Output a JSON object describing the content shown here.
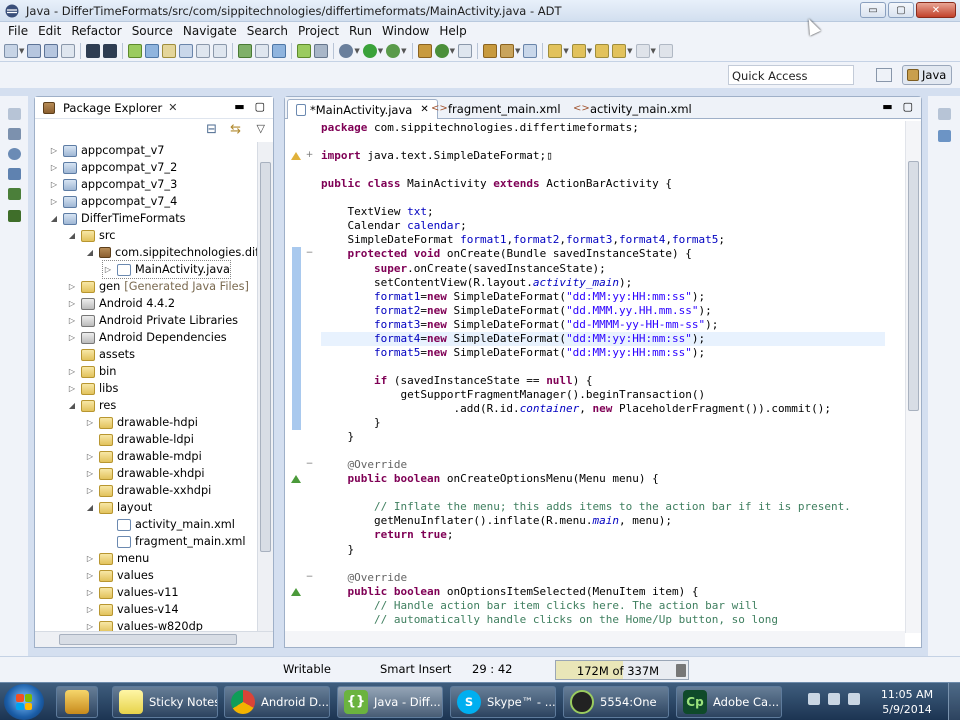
{
  "window": {
    "title": "Java - DifferTimeFormats/src/com/sippitechnologies/differtimeformats/MainActivity.java - ADT",
    "controls": {
      "minimize": "▭",
      "maximize": "▢",
      "close": "✕"
    }
  },
  "menu": [
    "File",
    "Edit",
    "Refactor",
    "Source",
    "Navigate",
    "Search",
    "Project",
    "Run",
    "Window",
    "Help"
  ],
  "quick_access": {
    "placeholder": "Quick Access"
  },
  "perspective": {
    "label": "Java"
  },
  "package_explorer": {
    "title": "Package Explorer",
    "close": "✕",
    "minimize": "▬",
    "maximize": "▢",
    "collapse": "⊟",
    "link": "⇆",
    "menu": "▽",
    "tree": [
      {
        "label": "appcompat_v7",
        "icon": "project",
        "twisty": "▷"
      },
      {
        "label": "appcompat_v7_2",
        "icon": "project",
        "twisty": "▷"
      },
      {
        "label": "appcompat_v7_3",
        "icon": "project",
        "twisty": "▷"
      },
      {
        "label": "appcompat_v7_4",
        "icon": "project",
        "twisty": "▷"
      },
      {
        "label": "DifferTimeFormats",
        "icon": "project",
        "twisty": "◢"
      },
      {
        "label": "src",
        "icon": "folder",
        "twisty": "◢"
      },
      {
        "label": "com.sippitechnologies.differ",
        "icon": "package",
        "twisty": "◢"
      },
      {
        "label": "MainActivity.java",
        "icon": "java",
        "twisty": "▷"
      },
      {
        "label": "gen",
        "decoration": "[Generated Java Files]",
        "icon": "folder",
        "twisty": "▷"
      },
      {
        "label": "Android 4.4.2",
        "icon": "library",
        "twisty": "▷"
      },
      {
        "label": "Android Private Libraries",
        "icon": "library",
        "twisty": "▷"
      },
      {
        "label": "Android Dependencies",
        "icon": "library",
        "twisty": "▷"
      },
      {
        "label": "assets",
        "icon": "folder",
        "twisty": ""
      },
      {
        "label": "bin",
        "icon": "folder",
        "twisty": "▷"
      },
      {
        "label": "libs",
        "icon": "folder",
        "twisty": "▷"
      },
      {
        "label": "res",
        "icon": "folder",
        "twisty": "◢"
      },
      {
        "label": "drawable-hdpi",
        "icon": "folder",
        "twisty": "▷"
      },
      {
        "label": "drawable-ldpi",
        "icon": "folder",
        "twisty": ""
      },
      {
        "label": "drawable-mdpi",
        "icon": "folder",
        "twisty": "▷"
      },
      {
        "label": "drawable-xhdpi",
        "icon": "folder",
        "twisty": "▷"
      },
      {
        "label": "drawable-xxhdpi",
        "icon": "folder",
        "twisty": "▷"
      },
      {
        "label": "layout",
        "icon": "folder",
        "twisty": "◢"
      },
      {
        "label": "activity_main.xml",
        "icon": "xml",
        "twisty": ""
      },
      {
        "label": "fragment_main.xml",
        "icon": "xml",
        "twisty": ""
      },
      {
        "label": "menu",
        "icon": "folder",
        "twisty": "▷"
      },
      {
        "label": "values",
        "icon": "folder",
        "twisty": "▷"
      },
      {
        "label": "values-v11",
        "icon": "folder",
        "twisty": "▷"
      },
      {
        "label": "values-v14",
        "icon": "folder",
        "twisty": "▷"
      },
      {
        "label": "values-w820dp",
        "icon": "folder",
        "twisty": "▷"
      }
    ]
  },
  "editor": {
    "tabs": [
      {
        "label": "*MainActivity.java",
        "active": true
      },
      {
        "label": "fragment_main.xml",
        "active": false
      },
      {
        "label": "activity_main.xml",
        "active": false
      }
    ],
    "close": "✕",
    "minimize": "▬",
    "maximize": "▢",
    "lines": [
      [
        [
          "package ",
          "kw"
        ],
        [
          "com.sippitechnologies.differtimeformats;",
          ""
        ]
      ],
      [],
      [
        [
          "import ",
          "kw"
        ],
        [
          "java.text.SimpleDateFormat;",
          ""
        ],
        [
          "▯",
          ""
        ]
      ],
      [],
      [
        [
          "public ",
          "kw"
        ],
        [
          "class ",
          "kw"
        ],
        [
          "MainActivity ",
          ""
        ],
        [
          "extends ",
          "kw"
        ],
        [
          "ActionBarActivity {",
          ""
        ]
      ],
      [],
      [
        [
          "    TextView ",
          ""
        ],
        [
          "txt",
          ""
        ],
        [
          ";",
          ""
        ]
      ],
      [
        [
          "    Calendar ",
          ""
        ],
        [
          "calendar",
          ""
        ],
        [
          ";",
          ""
        ]
      ],
      [
        [
          "    SimpleDateFormat ",
          ""
        ],
        [
          "format1",
          ""
        ],
        [
          ",",
          ""
        ],
        [
          "format2",
          ""
        ],
        [
          ",",
          ""
        ],
        [
          "format3",
          ""
        ],
        [
          ",",
          ""
        ],
        [
          "format4",
          ""
        ],
        [
          ",",
          ""
        ],
        [
          "format5",
          ""
        ],
        [
          ";",
          ""
        ]
      ],
      [
        [
          "    ",
          "kw"
        ],
        [
          "protected ",
          "kw"
        ],
        [
          "void ",
          "kw"
        ],
        [
          "onCreate(Bundle savedInstanceState) {",
          ""
        ]
      ],
      [
        [
          "        ",
          ""
        ],
        [
          "super",
          ""
        ],
        [
          ".onCreate(savedInstanceState);",
          ""
        ]
      ],
      [
        [
          "        setContentView(R.layout.",
          ""
        ],
        [
          "activity_main",
          ""
        ],
        [
          ");",
          ""
        ]
      ],
      [
        [
          "        ",
          ""
        ],
        [
          "format1",
          ""
        ],
        [
          "=",
          ""
        ],
        [
          "new ",
          "kw"
        ],
        [
          "SimpleDateFormat(",
          ""
        ],
        [
          "\"dd:MM:yy:HH:mm:ss\"",
          ""
        ],
        [
          ");",
          ""
        ]
      ],
      [
        [
          "        ",
          ""
        ],
        [
          "format2",
          ""
        ],
        [
          "=",
          ""
        ],
        [
          "new ",
          "kw"
        ],
        [
          "SimpleDateFormat(",
          ""
        ],
        [
          "\"dd.MMM.yy.HH.mm.ss\"",
          ""
        ],
        [
          ");",
          ""
        ]
      ],
      [
        [
          "        ",
          ""
        ],
        [
          "format3",
          ""
        ],
        [
          "=",
          ""
        ],
        [
          "new ",
          "kw"
        ],
        [
          "SimpleDateFormat(",
          ""
        ],
        [
          "\"dd-MMMM-yy-HH-mm-ss\"",
          ""
        ],
        [
          ");",
          ""
        ]
      ],
      [
        [
          "        ",
          ""
        ],
        [
          "format4",
          ""
        ],
        [
          "=",
          ""
        ],
        [
          "new ",
          "kw"
        ],
        [
          "SimpleDateFormat(",
          ""
        ],
        [
          "\"dd:MM:yy:HH:mm:ss\"",
          ""
        ],
        [
          ");",
          ""
        ]
      ],
      [
        [
          "        ",
          ""
        ],
        [
          "format5",
          ""
        ],
        [
          "=",
          ""
        ],
        [
          "new ",
          "kw"
        ],
        [
          "SimpleDateFormat(",
          ""
        ],
        [
          "\"dd:MM:yy:HH:mm:ss\"",
          ""
        ],
        [
          ");",
          ""
        ]
      ],
      [],
      [
        [
          "        ",
          ""
        ],
        [
          "if ",
          "kw"
        ],
        [
          "(savedInstanceState == ",
          ""
        ],
        [
          "null",
          ""
        ],
        [
          ") {",
          ""
        ]
      ],
      [
        [
          "            getSupportFragmentManager().beginTransaction()",
          ""
        ]
      ],
      [
        [
          "                    .add(R.id.",
          ""
        ],
        [
          "container",
          ""
        ],
        [
          ", ",
          ""
        ],
        [
          "new ",
          "kw"
        ],
        [
          "PlaceholderFragment()).commit();",
          ""
        ]
      ],
      [
        [
          "        }",
          ""
        ]
      ],
      [
        [
          "    }",
          ""
        ]
      ],
      [],
      [
        [
          "    ",
          ""
        ],
        [
          "@Override",
          ""
        ]
      ],
      [
        [
          "    ",
          ""
        ],
        [
          "public ",
          "kw"
        ],
        [
          "boolean ",
          "kw"
        ],
        [
          "onCreateOptionsMenu(Menu menu) {",
          ""
        ]
      ],
      [],
      [
        [
          "        ",
          ""
        ],
        [
          "// Inflate the menu; this adds items to the action bar if it is present.",
          ""
        ]
      ],
      [
        [
          "        getMenuInflater().inflate(R.menu.",
          ""
        ],
        [
          "main",
          ""
        ],
        [
          ", menu);",
          ""
        ]
      ],
      [
        [
          "        ",
          ""
        ],
        [
          "return ",
          "kw"
        ],
        [
          "true",
          ""
        ],
        [
          ";",
          ""
        ]
      ],
      [
        [
          "    }",
          ""
        ]
      ],
      [],
      [
        [
          "    ",
          ""
        ],
        [
          "@Override",
          ""
        ]
      ],
      [
        [
          "    ",
          ""
        ],
        [
          "public ",
          "kw"
        ],
        [
          "boolean ",
          "kw"
        ],
        [
          "onOptionsItemSelected(MenuItem item) {",
          ""
        ]
      ],
      [
        [
          "        ",
          ""
        ],
        [
          "// Handle action bar item clicks here. The action bar will",
          ""
        ]
      ],
      [
        [
          "        ",
          ""
        ],
        [
          "// automatically handle clicks on the Home/Up button, so long",
          ""
        ]
      ]
    ]
  },
  "status": {
    "writable": "Writable",
    "insert_mode": "Smart Insert",
    "position": "29 : 42",
    "heap": "172M of 337M",
    "heap_used_fraction": 0.51
  },
  "taskbar": {
    "items": [
      {
        "label": "",
        "kind": "pin"
      },
      {
        "label": "",
        "kind": "pin"
      },
      {
        "label": "Sticky Notes",
        "kind": "app"
      },
      {
        "label": "Android D...",
        "kind": "app"
      },
      {
        "label": "Java - Diff...",
        "kind": "app"
      },
      {
        "label": "Skype™ - ...",
        "kind": "app"
      },
      {
        "label": "5554:One",
        "kind": "app"
      },
      {
        "label": "Adobe Ca...",
        "kind": "app"
      }
    ],
    "time": "11:05 AM",
    "date": "5/9/2014"
  },
  "colors": {
    "keyword": "#7f0055",
    "field": "#0000c0",
    "string": "#2a00ff",
    "comment": "#3f7f5f",
    "annotation": "#646464"
  }
}
